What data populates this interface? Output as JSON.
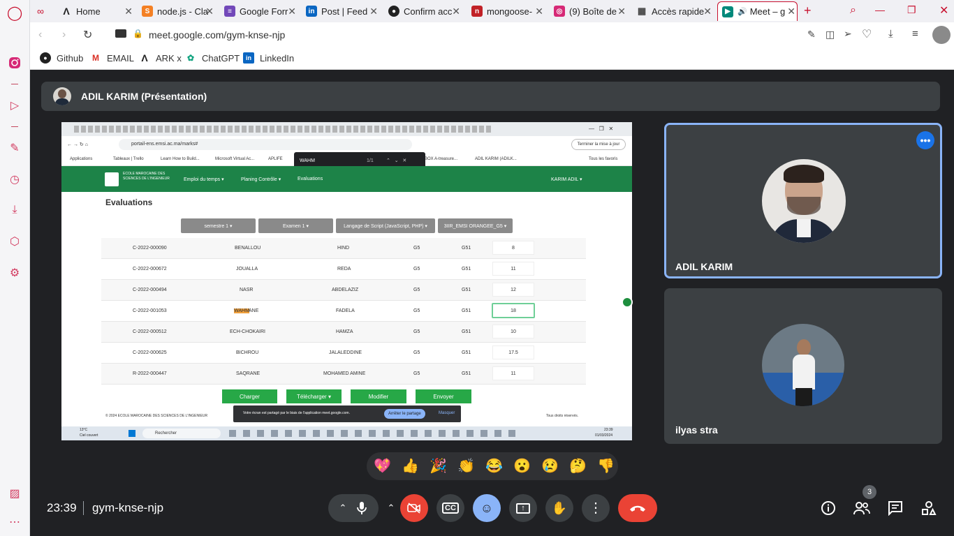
{
  "browser": {
    "tabs": [
      {
        "label": "Home",
        "icon": "ark-icon",
        "color": "#222"
      },
      {
        "label": "node.js - Cla",
        "icon": "stackoverflow-icon",
        "color": "#f48024"
      },
      {
        "label": "Google Forr",
        "icon": "google-forms-icon",
        "color": "#7248b9"
      },
      {
        "label": "Post | Feed",
        "icon": "linkedin-icon",
        "color": "#0a66c2"
      },
      {
        "label": "Confirm acc",
        "icon": "github-icon",
        "color": "#222"
      },
      {
        "label": "mongoose-",
        "icon": "npm-icon",
        "color": "#c12127"
      },
      {
        "label": "(9) Boîte de",
        "icon": "instagram-icon",
        "color": "#d62976"
      },
      {
        "label": "Accès rapide",
        "icon": "grid-icon",
        "color": "#444"
      },
      {
        "label": "Meet – g",
        "icon": "meet-icon",
        "color": "#00897b"
      }
    ],
    "url": "meet.google.com/gym-knse-njp",
    "bookmarks": [
      {
        "label": "Github",
        "icon": "github-icon"
      },
      {
        "label": "EMAIL",
        "icon": "gmail-icon"
      },
      {
        "label": "ARK x",
        "icon": "ark-icon"
      },
      {
        "label": "ChatGPT",
        "icon": "chatgpt-icon"
      },
      {
        "label": "LinkedIn",
        "icon": "linkedin-icon"
      }
    ]
  },
  "meet": {
    "presenter_label": "ADIL KARIM (Présentation)",
    "participants": [
      {
        "name": "ADIL KARIM"
      },
      {
        "name": "ilyas stra"
      }
    ],
    "time": "23:39",
    "meeting_code": "gym-knse-njp",
    "participant_count": "3",
    "emojis": [
      "💖",
      "👍",
      "🎉",
      "👏",
      "😂",
      "😮",
      "😢",
      "🤔",
      "👎"
    ]
  },
  "shared_screen": {
    "url": "portail-ens.emsi.ac.ma/marks#",
    "find_query": "WAHM",
    "find_count": "1/1",
    "update_button": "Terminer la mise à jour",
    "bookmarks": [
      "Applications",
      "Tableaux | Trello",
      "Learn How to Build...",
      "Microsoft Virtual Ac...",
      "APLIFE",
      "BOX A-treasure...",
      "ADIL KARIM (ADILK..."
    ],
    "all_favorites": "Tous les favoris",
    "school_name": "ECOLE MAROCAINE DES SCIENCES DE L'INGENIEUR",
    "nav": [
      "Emploi du temps ▾",
      "Planing Contrôle ▾",
      "Evaluations"
    ],
    "user_menu": "KARIM ADIL ▾",
    "page_title": "Evaluations",
    "filters": [
      "semestre 1 ▾",
      "Examen 1 ▾",
      "Langage de Script (JavaScript, PHP) ▾",
      "3IIR_EMSI ORANGEE_G5 ▾"
    ],
    "rows": [
      {
        "id": "C-2022-000090",
        "last": "BENALLOU",
        "first": "HIND",
        "group": "G5",
        "sub": "G51",
        "mark": "8"
      },
      {
        "id": "C-2022-000672",
        "last": "JOUALLA",
        "first": "REDA",
        "group": "G5",
        "sub": "G51",
        "mark": "11"
      },
      {
        "id": "C-2022-000494",
        "last": "NASR",
        "first": "ABDELAZIZ",
        "group": "G5",
        "sub": "G51",
        "mark": "12"
      },
      {
        "id": "C-2022-001053",
        "last_hl": "WAHM",
        "last_rest": "ANE",
        "first": "FADELA",
        "group": "G5",
        "sub": "G51",
        "mark": "18"
      },
      {
        "id": "C-2022-000512",
        "last": "ECH-CHOKAIRI",
        "first": "HAMZA",
        "group": "G5",
        "sub": "G51",
        "mark": "10"
      },
      {
        "id": "C-2022-000625",
        "last": "BICHROU",
        "first": "JALALEDDINE",
        "group": "G5",
        "sub": "G51",
        "mark": "17.5"
      },
      {
        "id": "R-2022-000447",
        "last": "SAQRANE",
        "first": "MOHAMED AMINE",
        "group": "G5",
        "sub": "G51",
        "mark": "11"
      }
    ],
    "buttons": [
      "Charger",
      "Télécharger ▾",
      "Modifier",
      "Envoyer"
    ],
    "footer_left": "© 2024 ECOLE MAROCAINE DES SCIENCES DE L'INGENIEUR",
    "footer_right": "Tous droits réservés.",
    "share_notice": "Votre écran est partagé par le biais de l'application meet.google.com.",
    "stop_share": "Arrêter le partage",
    "hide": "Masquer",
    "weather_temp": "13°C",
    "weather_desc": "Ciel couvert",
    "search_label": "Rechercher",
    "taskbar_time": "23:39",
    "taskbar_date": "01/03/2024"
  }
}
